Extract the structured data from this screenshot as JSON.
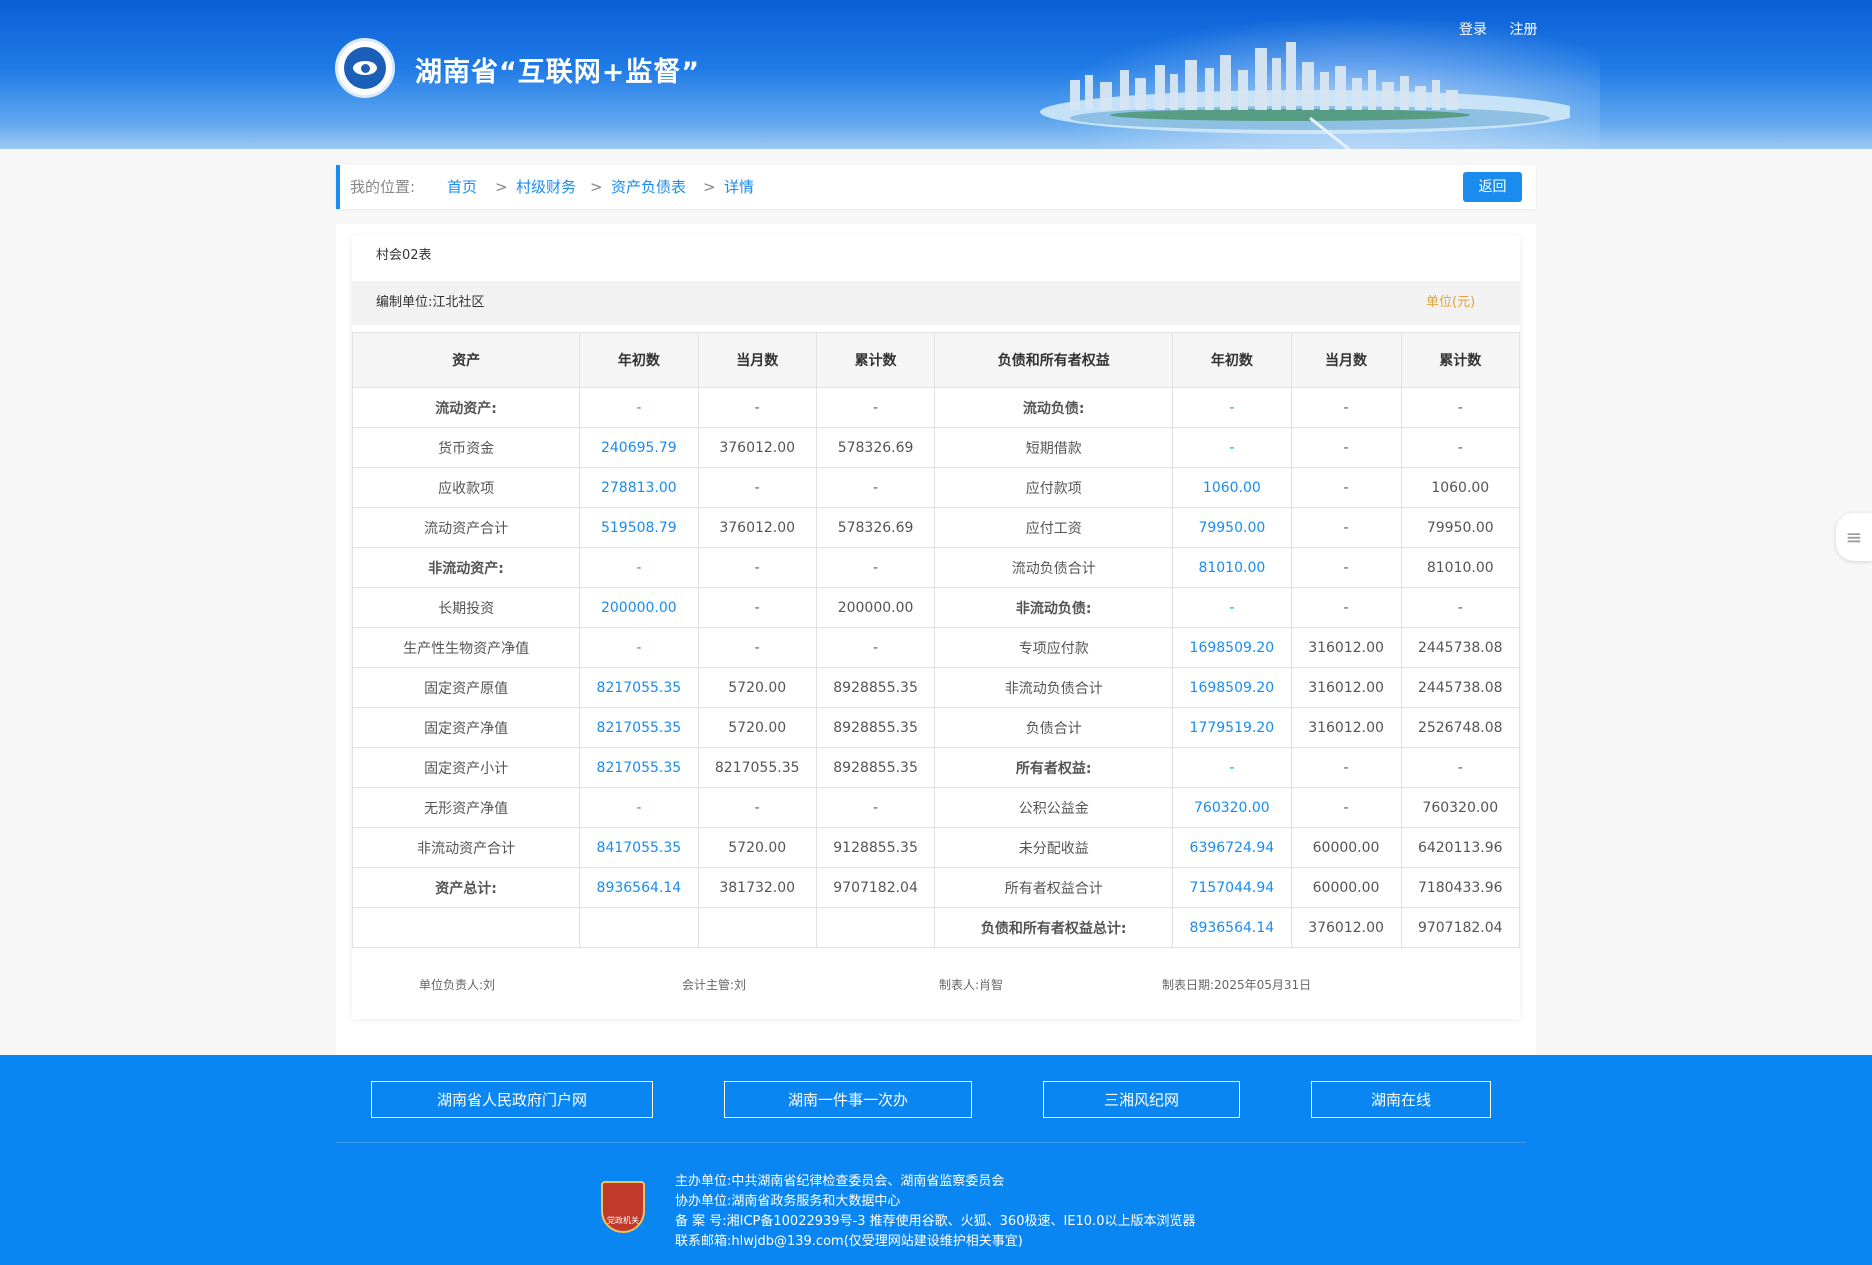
{
  "header": {
    "site_title": "湖南省“互联网+监督”",
    "login": "登录",
    "register": "注册"
  },
  "breadcrumb": {
    "label": "我的位置:",
    "items": [
      "首页",
      "村级财务",
      "资产负债表",
      "详情"
    ],
    "separator": ">",
    "back": "返回"
  },
  "report": {
    "form_code": "村会02表",
    "org": "编制单位:江北社区",
    "unit": "单位(元)",
    "headers": [
      "资产",
      "年初数",
      "当月数",
      "累计数",
      "负债和所有者权益",
      "年初数",
      "当月数",
      "累计数"
    ],
    "rows": [
      [
        "流动资产:",
        "-",
        "-",
        "-",
        "流动负债:",
        "-",
        "-",
        "-"
      ],
      [
        "货币资金",
        "240695.79",
        "376012.00",
        "578326.69",
        "短期借款",
        "-",
        "-",
        "-"
      ],
      [
        "应收款项",
        "278813.00",
        "-",
        "-",
        "应付款项",
        "1060.00",
        "-",
        "1060.00"
      ],
      [
        "流动资产合计",
        "519508.79",
        "376012.00",
        "578326.69",
        "应付工资",
        "79950.00",
        "-",
        "79950.00"
      ],
      [
        "非流动资产:",
        "-",
        "-",
        "-",
        "流动负债合计",
        "81010.00",
        "-",
        "81010.00"
      ],
      [
        "长期投资",
        "200000.00",
        "-",
        "200000.00",
        "非流动负债:",
        "-",
        "-",
        "-"
      ],
      [
        "生产性生物资产净值",
        "-",
        "-",
        "-",
        "专项应付款",
        "1698509.20",
        "316012.00",
        "2445738.08"
      ],
      [
        "固定资产原值",
        "8217055.35",
        "5720.00",
        "8928855.35",
        "非流动负债合计",
        "1698509.20",
        "316012.00",
        "2445738.08"
      ],
      [
        "固定资产净值",
        "8217055.35",
        "5720.00",
        "8928855.35",
        "负债合计",
        "1779519.20",
        "316012.00",
        "2526748.08"
      ],
      [
        "固定资产小计",
        "8217055.35",
        "8217055.35",
        "8928855.35",
        "所有者权益:",
        "-",
        "-",
        "-"
      ],
      [
        "无形资产净值",
        "-",
        "-",
        "-",
        "公积公益金",
        "760320.00",
        "-",
        "760320.00"
      ],
      [
        "非流动资产合计",
        "8417055.35",
        "5720.00",
        "9128855.35",
        "未分配收益",
        "6396724.94",
        "60000.00",
        "6420113.96"
      ],
      [
        "资产总计:",
        "8936564.14",
        "381732.00",
        "9707182.04",
        "所有者权益合计",
        "7157044.94",
        "60000.00",
        "7180433.96"
      ],
      [
        "",
        "",
        "",
        "",
        "负债和所有者权益总计:",
        "8936564.14",
        "376012.00",
        "9707182.04"
      ]
    ],
    "bold_left": [
      0,
      4,
      12
    ],
    "bold_right": [
      0,
      5,
      9,
      13
    ],
    "signers": [
      "单位负责人:刘",
      "会计主管:刘",
      "制表人:肖智",
      "制表日期:2025年05月31日"
    ]
  },
  "footer": {
    "links": [
      "湖南省人民政府门户网",
      "湖南一件事一次办",
      "三湘风纪网",
      "湖南在线"
    ],
    "emblem_text": "党政机关",
    "host": "主办单位:中共湖南省纪律检查委员会、湖南省监察委员会",
    "co_host": "协办单位:湖南省政务服务和大数据中心",
    "icp": "备  案  号:湘ICP备10022939号-3   推荐使用谷歌、火狐、360极速、IE10.0以上版本浏览器",
    "email": "联系邮箱:hlwjdb@139.com(仅受理网站建设维护相关事宜)"
  },
  "colors": {
    "accent": "#1a8cf0",
    "footer_bg": "#0a86f2",
    "unit_text": "#e0a33a"
  },
  "icons": {
    "logo": "eye-seal-logo-icon",
    "side": "collapse-menu-icon",
    "emblem": "party-emblem-icon"
  }
}
